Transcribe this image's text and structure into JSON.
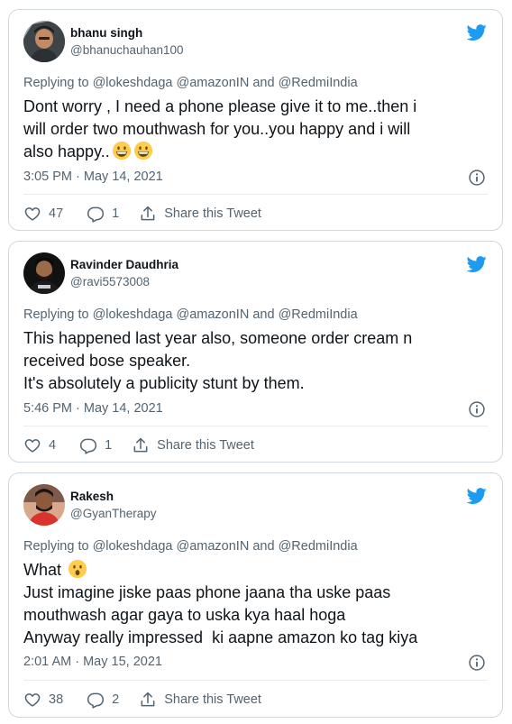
{
  "tweets": [
    {
      "name": "bhanu singh",
      "handle": "@bhanuchauhan100",
      "replying_prefix": "Replying to",
      "mentions": [
        "@lokeshdaga",
        "@amazonIN",
        "and",
        "@RedmiIndia"
      ],
      "body_lines": [
        "Dont worry , I need a phone please give it to me..then i",
        "will order two mouthwash for you..you happy and i will",
        "also happy.."
      ],
      "timestamp": "3:05 PM · May 14, 2021",
      "likes": "47",
      "replies": "1",
      "share_label": "Share this Tweet"
    },
    {
      "name": "Ravinder Daudhria",
      "handle": "@ravi5573008",
      "replying_prefix": "Replying to",
      "mentions": [
        "@lokeshdaga",
        "@amazonIN",
        "and",
        "@RedmiIndia"
      ],
      "body_lines": [
        "This happened last year also, someone order cream n",
        "received bose speaker.",
        "It's absolutely a publicity stunt by them."
      ],
      "timestamp": "5:46 PM · May 14, 2021",
      "likes": "4",
      "replies": "1",
      "share_label": "Share this Tweet"
    },
    {
      "name": "Rakesh",
      "handle": "@GyanTherapy",
      "replying_prefix": "Replying to",
      "mentions": [
        "@lokeshdaga",
        "@amazonIN",
        "and",
        "@RedmiIndia"
      ],
      "body_lines": [
        "What",
        "Just imagine jiske paas phone jaana tha uske paas",
        "mouthwash agar gaya to uska kya haal hoga",
        "Anyway really impressed  ki aapne amazon ko tag kiya"
      ],
      "timestamp": "2:01 AM · May 15, 2021",
      "likes": "38",
      "replies": "2",
      "share_label": "Share this Tweet"
    }
  ],
  "icons": {
    "brand": "twitter-bird-icon",
    "info": "info-icon",
    "like": "heart-icon",
    "reply": "reply-icon",
    "share": "share-icon"
  },
  "colors": {
    "twitter_blue": "#1d9bf0",
    "muted_text": "#536471",
    "border": "#cfd9de",
    "emoji_yellow": "#ffcc4d"
  }
}
